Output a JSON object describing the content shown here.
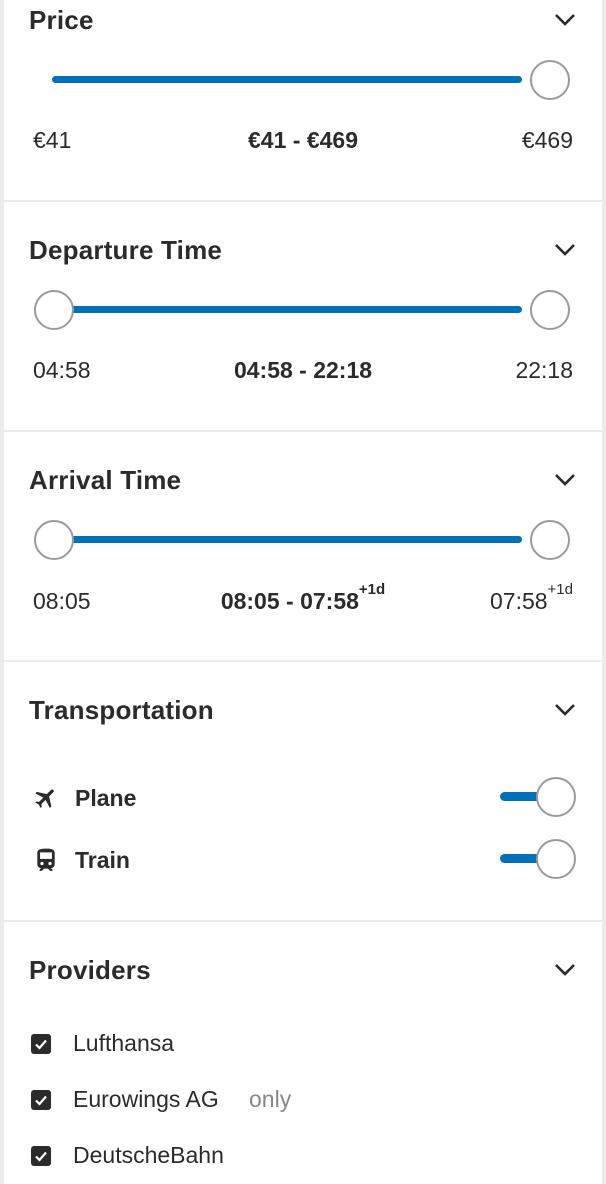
{
  "price": {
    "title": "Price",
    "min_label": "€41",
    "range_label": "€41 - €469",
    "max_label": "€469",
    "range_selected_fraction": [
      0.0,
      1.0
    ]
  },
  "departure": {
    "title": "Departure Time",
    "min_label": "04:58",
    "range_label": "04:58 - 22:18",
    "max_label": "22:18",
    "range_selected_fraction": [
      0.0,
      1.0
    ]
  },
  "arrival": {
    "title": "Arrival Time",
    "min_label": "08:05",
    "range_label_start": "08:05 - 07:58",
    "range_label_sup": "+1d",
    "max_label": "07:58",
    "max_sup": "+1d",
    "range_selected_fraction": [
      0.0,
      1.0
    ]
  },
  "transportation": {
    "title": "Transportation",
    "items": [
      {
        "label": "Plane",
        "icon": "plane-icon",
        "enabled": true
      },
      {
        "label": "Train",
        "icon": "train-icon",
        "enabled": true
      }
    ]
  },
  "providers": {
    "title": "Providers",
    "only_label": "only",
    "items": [
      {
        "label": "Lufthansa",
        "checked": true
      },
      {
        "label": "Eurowings AG",
        "checked": true
      },
      {
        "label": "DeutscheBahn",
        "checked": true
      }
    ]
  },
  "colors": {
    "accent": "#0071b8",
    "divider": "#ececec",
    "text": "#2b2b2b",
    "muted": "#888888"
  }
}
